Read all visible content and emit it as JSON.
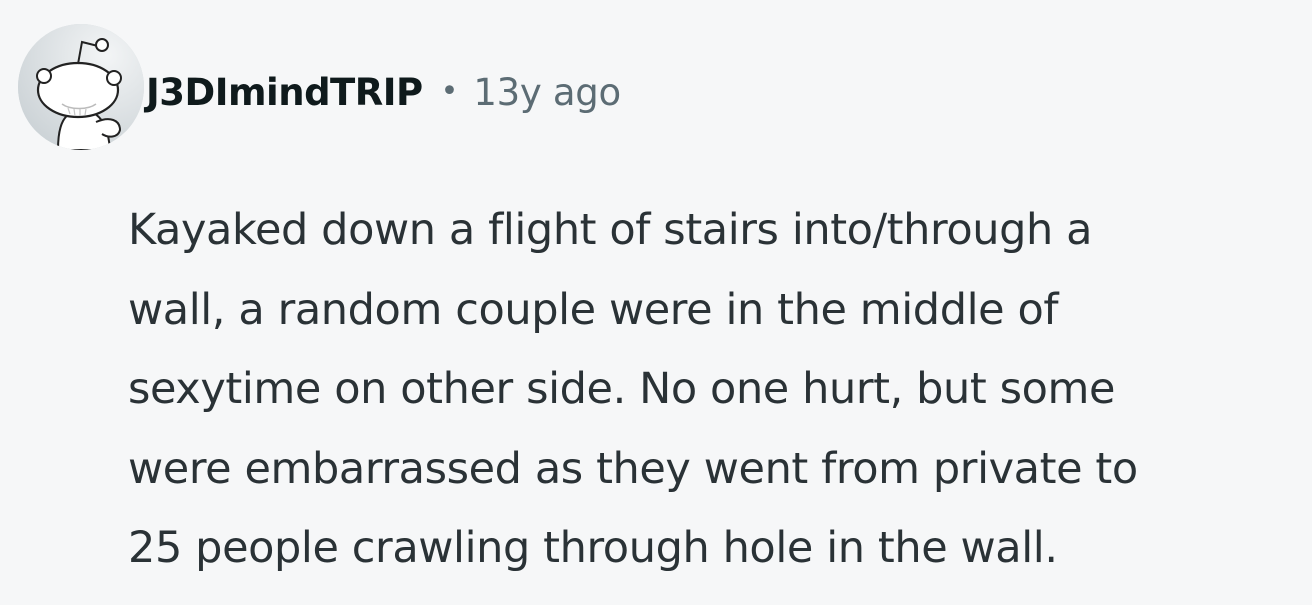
{
  "comment": {
    "avatar_icon": "reddit-snoo-avatar-icon",
    "author": "J3DImindTRIP",
    "separator": "•",
    "timestamp": "13y ago",
    "body_lines": [
      "Kayaked down a flight of stairs into/through a",
      "wall, a random couple were in the middle of",
      "sexytime on other side. No one hurt, but some",
      "were embarrassed as they went from private to",
      "25 people crawling through hole in the wall."
    ]
  },
  "colors": {
    "background": "#f6f7f8",
    "author_text": "#0f1a1c",
    "meta_text": "#5c6c74",
    "body_text": "#2a3236",
    "avatar_bg": "#d4dadd"
  }
}
